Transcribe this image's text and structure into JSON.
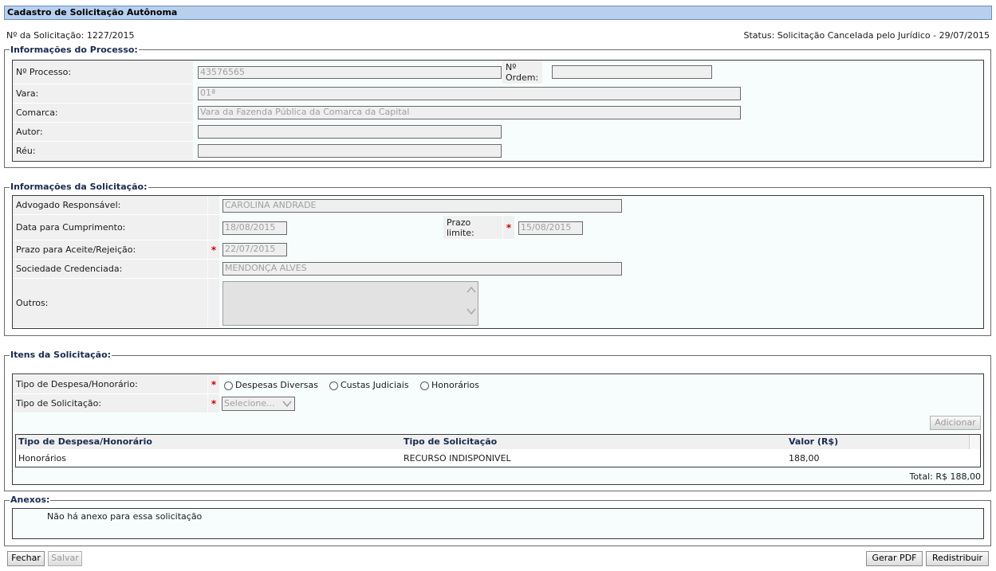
{
  "page": {
    "title": "Cadastro de Solicitação Autônoma",
    "solicitacao": "Nº da Solicitação: 1227/2015",
    "status": "Status: Solicitação Cancelada pelo Jurídico - 29/07/2015"
  },
  "processo": {
    "legend": "Informações do Processo:",
    "processo_label": "Nº Processo:",
    "processo_value": "43576565",
    "ordem_label_1": "Nº",
    "ordem_label_2": "Ordem:",
    "ordem_value": "",
    "vara_label": "Vara:",
    "vara_value": "01ª",
    "comarca_label": "Comarca:",
    "comarca_value": "Vara da Fazenda Pública da Comarca da Capital",
    "autor_label": "Autor:",
    "autor_value": "",
    "reu_label": "Réu:",
    "reu_value": ""
  },
  "solicitacao": {
    "legend": "Informações da Solicitação:",
    "advogado_label": "Advogado Responsável:",
    "advogado_value": "CAROLINA ANDRADE",
    "data_label": "Data para Cumprimento:",
    "data_value": "18/08/2015",
    "prazo_limite_label_1": "Prazo",
    "prazo_limite_label_2": "limite:",
    "prazo_limite_value": "15/08/2015",
    "prazo_aceite_label": "Prazo para Aceite/Rejeição:",
    "prazo_aceite_value": "22/07/2015",
    "sociedade_label": "Sociedade Credenciada:",
    "sociedade_value": "MENDONÇA ALVES",
    "outros_label": "Outros:",
    "outros_value": "",
    "required_mark": "*"
  },
  "itens": {
    "legend": "Itens da Solicitação:",
    "tipo_despesa_label": "Tipo de Despesa/Honorário:",
    "radio_options": [
      "Despesas Diversas",
      "Custas Judiciais",
      "Honorários"
    ],
    "tipo_solicitacao_label": "Tipo de Solicitação:",
    "select_value": "Selecione...",
    "adicionar_label": "Adicionar",
    "table_headers": [
      "Tipo de Despesa/Honorário",
      "Tipo de Solicitação",
      "Valor (R$)"
    ],
    "rows": [
      [
        "Honorários",
        "RECURSO INDISPONIVEL",
        "188,00"
      ]
    ],
    "total": "Total: R$ 188,00"
  },
  "anexos": {
    "legend": "Anexos:",
    "empty_text": "Não há anexo para essa solicitação"
  },
  "footer": {
    "fechar": "Fechar",
    "salvar": "Salvar",
    "gerar_pdf": "Gerar PDF",
    "redistribuir": "Redistribuir"
  }
}
